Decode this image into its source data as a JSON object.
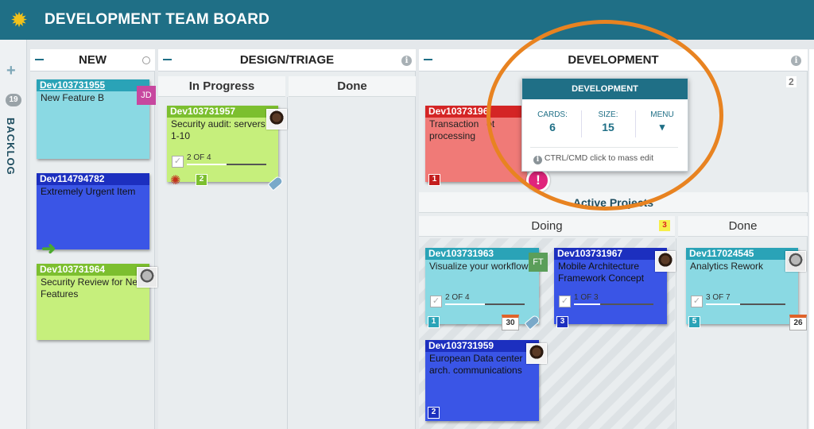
{
  "app": {
    "title": "DEVELOPMENT TEAM BOARD",
    "logo_icon": "gear-icon"
  },
  "rail": {
    "add_icon": "+",
    "count": "19",
    "label": "BACKLOG"
  },
  "lanes": {
    "new": {
      "title": "NEW"
    },
    "design": {
      "title": "DESIGN/TRIAGE",
      "sub": {
        "in_progress": "In Progress",
        "done": "Done"
      }
    },
    "development": {
      "title": "DEVELOPMENT",
      "count": "2"
    }
  },
  "active_projects": {
    "title": "Active Projects",
    "doing": "Doing",
    "doing_count": "3",
    "done": "Done"
  },
  "popup": {
    "title": "DEVELOPMENT",
    "cards_label": "CARDS:",
    "cards_value": "6",
    "size_label": "SIZE:",
    "size_value": "15",
    "menu_label": "MENU",
    "menu_caret": "▾",
    "hint": "CTRL/CMD click to mass edit"
  },
  "cards": {
    "c1": {
      "id": "Dev103731955",
      "title": "New Feature B",
      "initials": "JD"
    },
    "c2": {
      "id": "Dev114794782",
      "title": "Extremely Urgent Item"
    },
    "c3": {
      "id": "Dev103731964",
      "title": "Security Review for New Features"
    },
    "c4": {
      "id": "Dev103731957",
      "title": "Security audit: servers 1-10",
      "progress": "2 OF 4",
      "size": "2"
    },
    "c5": {
      "id": "Dev10373196",
      "title": "Transaction   ot processing",
      "size": "1"
    },
    "c6": {
      "id": "Dev103731963",
      "title": "Visualize your workflow",
      "initials": "FT",
      "progress": "2 OF 4",
      "size": "1",
      "date": "30"
    },
    "c7": {
      "id": "Dev103731967",
      "title": "Mobile Architecture Framework Concept",
      "progress": "1 OF 3",
      "size": "3"
    },
    "c8": {
      "id": "Dev117024545",
      "title": "Analytics Rework",
      "progress": "3 OF 7",
      "size": "5",
      "date": "26"
    },
    "c9": {
      "id": "Dev103731959",
      "title": "European Data center arch. communications",
      "size": "2"
    }
  },
  "colors": {
    "header": "#1f6f86",
    "cyan_card": "#8ad9e3",
    "blue_card": "#3a55e6",
    "green_card": "#c6ef7c",
    "red_card": "#f07a77",
    "highlight": "#e88321"
  }
}
